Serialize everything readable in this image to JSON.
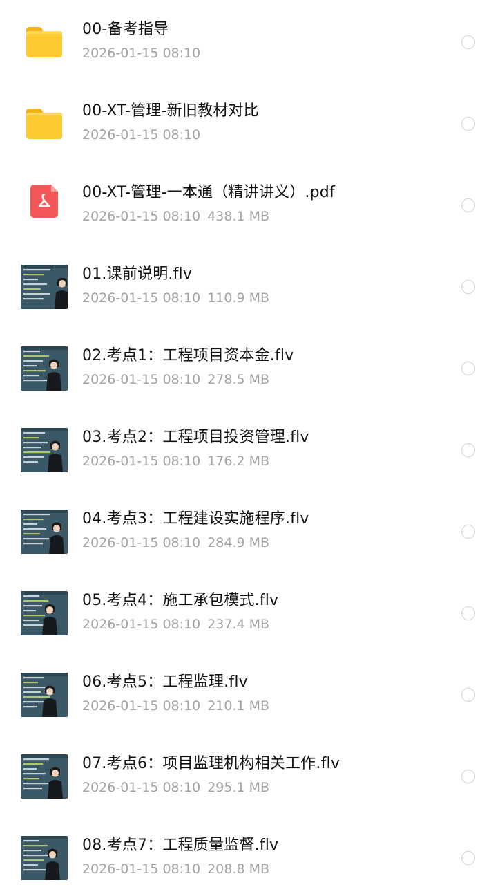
{
  "files": [
    {
      "type": "folder",
      "icon": "folder-icon",
      "name": "00-备考指导",
      "date": "2026-01-15 08:10",
      "size": ""
    },
    {
      "type": "folder",
      "icon": "folder-icon",
      "name": "00-XT-管理-新旧教材对比",
      "date": "2026-01-15 08:10",
      "size": ""
    },
    {
      "type": "pdf",
      "icon": "pdf-file-icon",
      "name": "00-XT-管理-一本通（精讲讲义）.pdf",
      "date": "2026-01-15 08:10",
      "size": "438.1 MB"
    },
    {
      "type": "video",
      "icon": "video-thumbnail",
      "name": "01.课前说明.flv",
      "date": "2026-01-15 08:10",
      "size": "110.9 MB"
    },
    {
      "type": "video",
      "icon": "video-thumbnail",
      "name": "02.考点1：工程项目资本金.flv",
      "date": "2026-01-15 08:10",
      "size": "278.5 MB"
    },
    {
      "type": "video",
      "icon": "video-thumbnail",
      "name": "03.考点2：工程项目投资管理.flv",
      "date": "2026-01-15 08:10",
      "size": "176.2 MB"
    },
    {
      "type": "video",
      "icon": "video-thumbnail",
      "name": "04.考点3：工程建设实施程序.flv",
      "date": "2026-01-15 08:10",
      "size": "284.9 MB"
    },
    {
      "type": "video",
      "icon": "video-thumbnail",
      "name": "05.考点4：施工承包模式.flv",
      "date": "2026-01-15 08:10",
      "size": "237.4 MB"
    },
    {
      "type": "video",
      "icon": "video-thumbnail",
      "name": "06.考点5：工程监理.flv",
      "date": "2026-01-15 08:10",
      "size": "210.1 MB"
    },
    {
      "type": "video",
      "icon": "video-thumbnail",
      "name": "07.考点6：项目监理机构相关工作.flv",
      "date": "2026-01-15 08:10",
      "size": "295.1 MB"
    },
    {
      "type": "video",
      "icon": "video-thumbnail",
      "name": "08.考点7：工程质量监督.flv",
      "date": "2026-01-15 08:10",
      "size": "208.8 MB"
    }
  ],
  "colors": {
    "folder": "#ffc932",
    "pdf": "#f3575a",
    "video_bg": "#3f5a67",
    "text_primary": "#121212",
    "text_secondary": "#a3a3a3"
  }
}
